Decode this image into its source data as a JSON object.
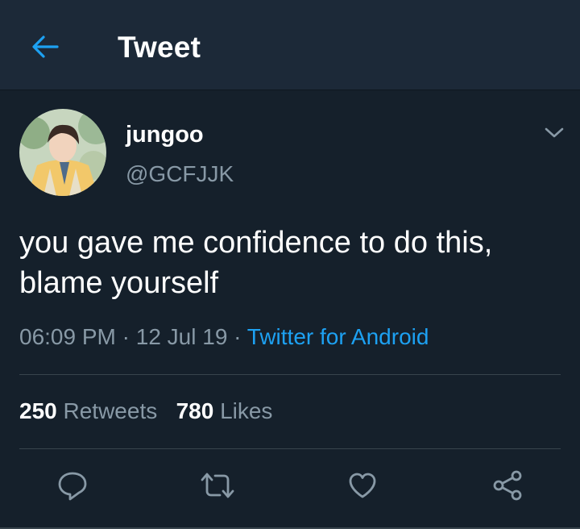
{
  "header": {
    "back_icon": "arrow-left-icon",
    "title": "Tweet"
  },
  "tweet": {
    "author": {
      "display_name": "jungoo",
      "handle": "@GCFJJK"
    },
    "text": "you gave me confidence to do this, blame yourself",
    "time": "06:09 PM",
    "separator": "·",
    "date": "12 Jul 19",
    "source": "Twitter for Android",
    "retweets_count": "250",
    "retweets_label": "Retweets",
    "likes_count": "780",
    "likes_label": "Likes"
  },
  "actions": [
    {
      "icon": "reply-icon"
    },
    {
      "icon": "retweet-icon"
    },
    {
      "icon": "heart-icon"
    },
    {
      "icon": "share-icon"
    }
  ],
  "colors": {
    "background": "#15202b",
    "header": "#1c2938",
    "accent": "#1da1f2",
    "secondary_text": "#8899a6",
    "divider": "#38444d"
  }
}
